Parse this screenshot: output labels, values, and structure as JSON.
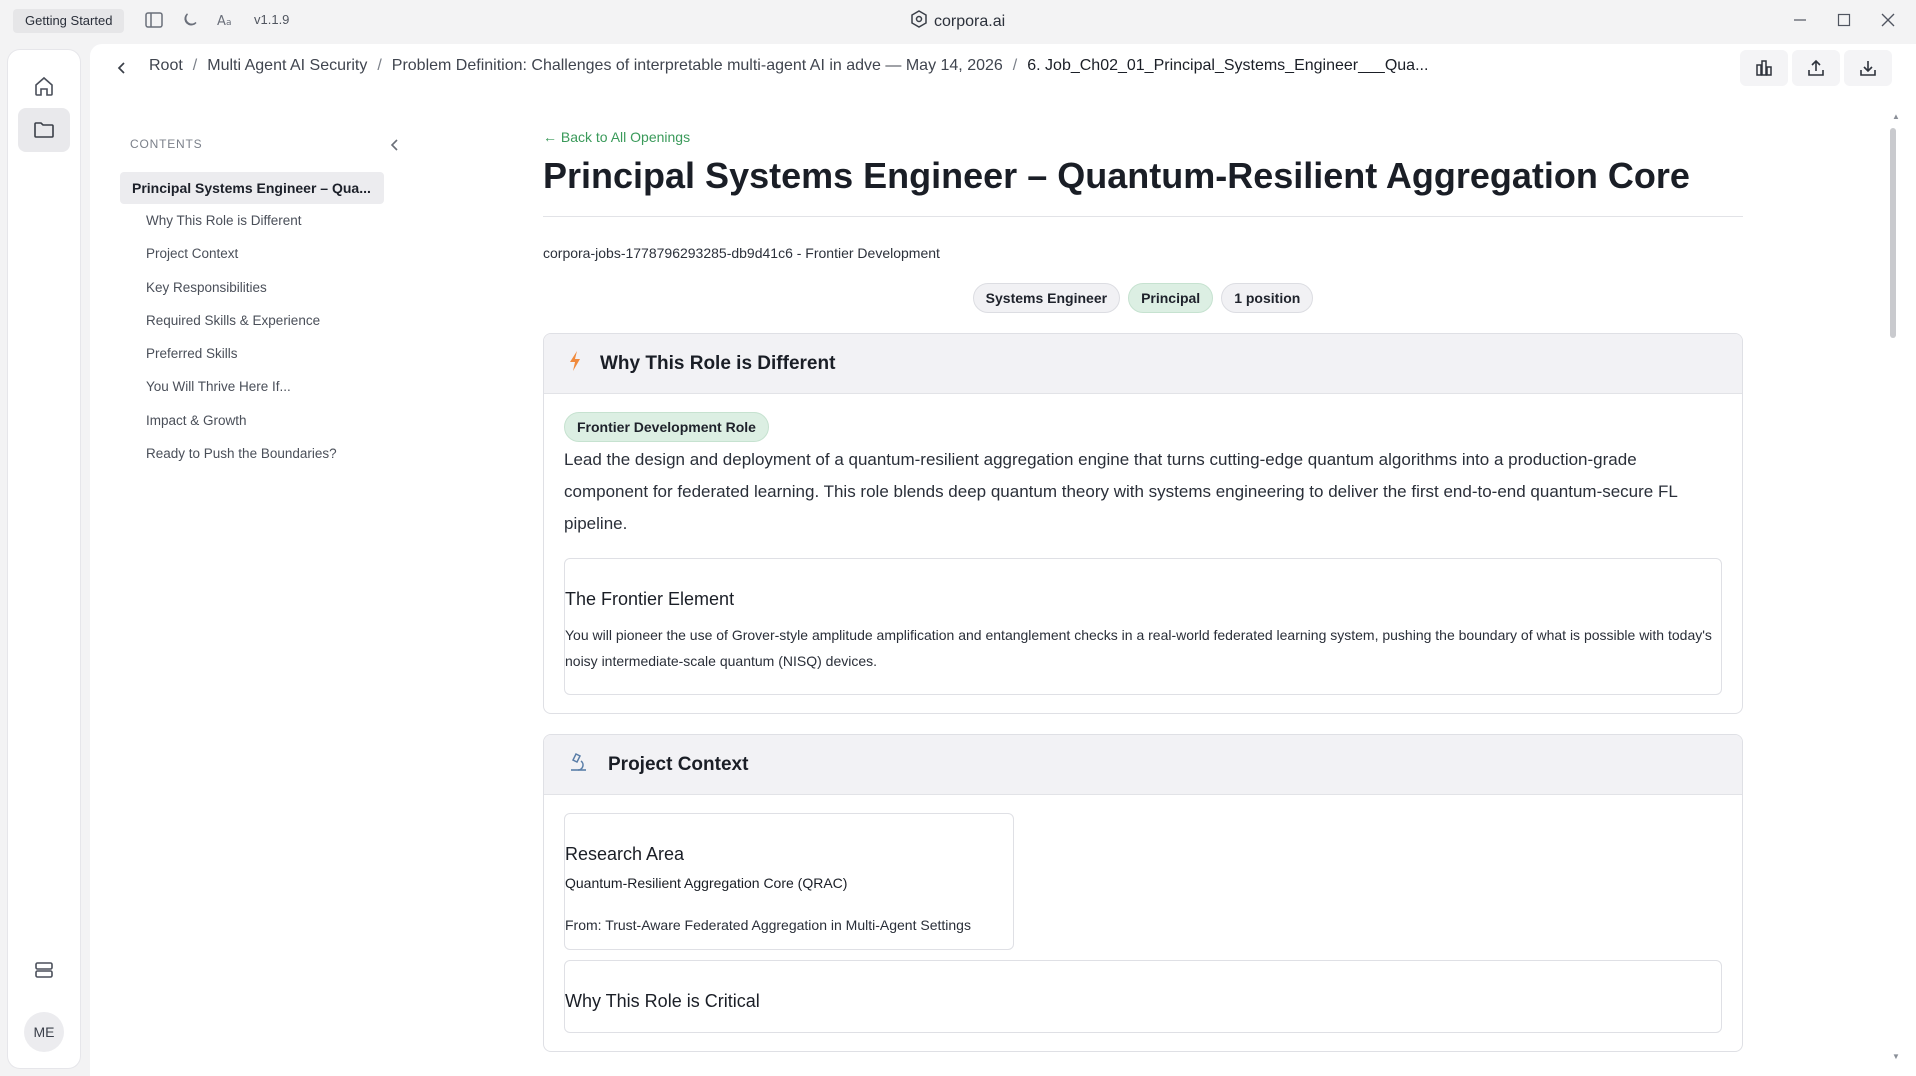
{
  "titlebar": {
    "getting_started": "Getting Started",
    "version": "v1.1.9",
    "app_title": "corpora.ai"
  },
  "rail": {
    "avatar_initials": "ME"
  },
  "breadcrumb": {
    "items": [
      "Root",
      "Multi Agent AI Security",
      "Problem Definition: Challenges of interpretable multi-agent AI in adve — May 14, 2026",
      "6. Job_Ch02_01_Principal_Systems_Engineer___Qua..."
    ]
  },
  "toc": {
    "heading": "CONTENTS",
    "main_item": "Principal Systems Engineer – Qua...",
    "items": [
      "Why This Role is Different",
      "Project Context",
      "Key Responsibilities",
      "Required Skills & Experience",
      "Preferred Skills",
      "You Will Thrive Here If...",
      "Impact & Growth",
      "Ready to Push the Boundaries?"
    ]
  },
  "content": {
    "back_link": "← Back to All Openings",
    "title": "Principal Systems Engineer – Quantum-Resilient Aggregation Core",
    "job_meta": "corpora-jobs-1778796293285-db9d41c6 - Frontier Development",
    "pills": [
      "Systems Engineer",
      "Principal",
      "1 position"
    ],
    "why": {
      "heading": "Why This Role is Different",
      "tag": "Frontier Development Role",
      "lead": "Lead the design and deployment of a quantum-resilient aggregation engine that turns cutting-edge quantum algorithms into a production-grade component for federated learning. This role blends deep quantum theory with systems engineering to deliver the first end-to-end quantum-secure FL pipeline.",
      "frontier_title": "The Frontier Element",
      "frontier_text": "You will pioneer the use of Grover-style amplitude amplification and entanglement checks in a real-world federated learning system, pushing the boundary of what is possible with today's noisy intermediate-scale quantum (NISQ) devices."
    },
    "project": {
      "heading": "Project Context",
      "research_title": "Research Area",
      "research_name": "Quantum-Resilient Aggregation Core (QRAC)",
      "research_from": "From: Trust-Aware Federated Aggregation in Multi-Agent Settings",
      "critical_title": "Why This Role is Critical"
    }
  }
}
